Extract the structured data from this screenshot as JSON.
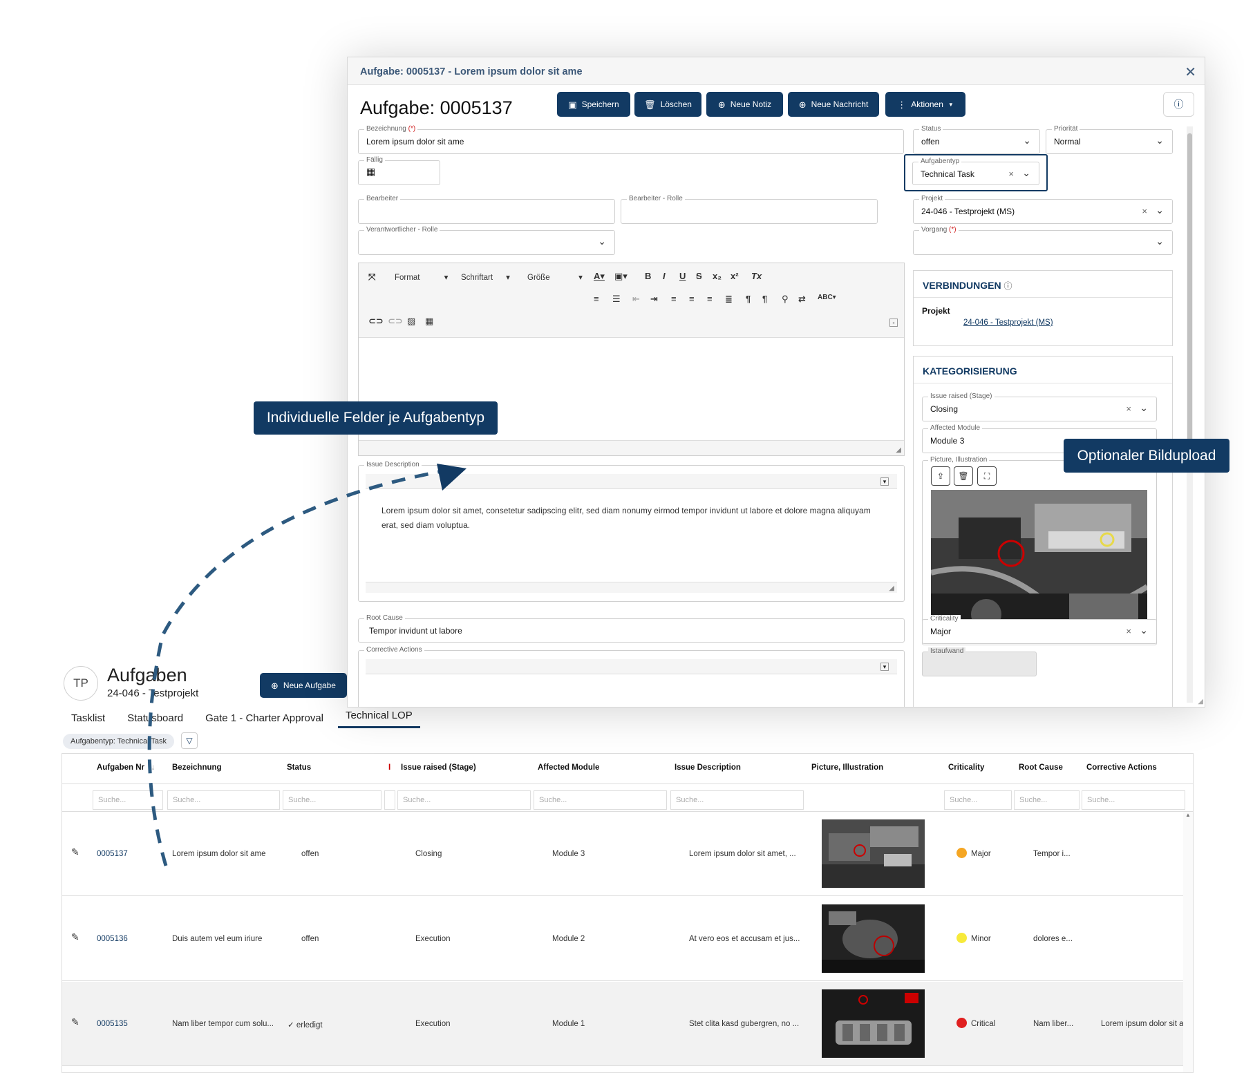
{
  "list": {
    "badge": "TP",
    "title": "Aufgaben",
    "subtitle": "24-046 - Testprojekt",
    "new_button": "Neue Aufgabe",
    "tabs": [
      {
        "label": "Tasklist"
      },
      {
        "label": "Statusboard"
      },
      {
        "label": "Gate 1 - Charter Approval"
      },
      {
        "label": "Technical LOP"
      }
    ],
    "active_tab": "Technical LOP",
    "filter_chip": "Aufgabentyp: Technical Task",
    "columns": [
      "Aufgaben Nr",
      "Bezeichnung",
      "Status",
      "I",
      "Issue raised (Stage)",
      "Affected Module",
      "Issue Description",
      "Picture, Illustration",
      "Criticality",
      "Root Cause",
      "Corrective Actions"
    ],
    "search_placeholder": "Suche...",
    "rows": [
      {
        "nr": "0005137",
        "bezeichnung": "Lorem ipsum dolor sit ame",
        "status": "offen",
        "stage": "Closing",
        "module": "Module 3",
        "description": "Lorem ipsum dolor sit amet, ...",
        "criticality": "Major",
        "crit_color": "#f5a623",
        "root_cause": "Tempor i...",
        "corrective": ""
      },
      {
        "nr": "0005136",
        "bezeichnung": "Duis autem vel eum iriure",
        "status": "offen",
        "stage": "Execution",
        "module": "Module 2",
        "description": "At vero eos et accusam et jus...",
        "criticality": "Minor",
        "crit_color": "#f7ea3b",
        "root_cause": "dolores e...",
        "corrective": ""
      },
      {
        "nr": "0005135",
        "bezeichnung": "Nam liber tempor cum solu...",
        "status": "erledigt",
        "stage": "Execution",
        "module": "Module 1",
        "description": "Stet clita kasd gubergren, no ...",
        "criticality": "Critical",
        "crit_color": "#e02020",
        "root_cause": "Nam liber...",
        "corrective": "Lorem ipsum dolor sit a"
      }
    ]
  },
  "modal": {
    "titlebar": "Aufgabe: 0005137 - Lorem ipsum dolor sit ame",
    "title": "Aufgabe: 0005137",
    "buttons": {
      "save": "Speichern",
      "delete": "Löschen",
      "note": "Neue Notiz",
      "message": "Neue Nachricht",
      "actions": "Aktionen"
    },
    "fields": {
      "bezeichnung": {
        "label": "Bezeichnung",
        "req": "(*)",
        "value": "Lorem ipsum dolor sit ame"
      },
      "status": {
        "label": "Status",
        "value": "offen"
      },
      "prioritaet": {
        "label": "Priorität",
        "value": "Normal"
      },
      "faellig": {
        "label": "Fällig"
      },
      "aufgabentyp": {
        "label": "Aufgabentyp",
        "value": "Technical Task"
      },
      "bearbeiter": {
        "label": "Bearbeiter"
      },
      "bearbeiter_rolle": {
        "label": "Bearbeiter - Rolle"
      },
      "projekt": {
        "label": "Projekt",
        "value": "24-046 - Testprojekt (MS)"
      },
      "verantwortlicher_rolle": {
        "label": "Verantwortlicher - Rolle"
      },
      "vorgang": {
        "label": "Vorgang",
        "req": "(*)"
      },
      "issue_description": {
        "label": "Issue Description",
        "value": "Lorem ipsum dolor sit amet, consetetur sadipscing elitr, sed diam nonumy eirmod tempor invidunt ut labore et dolore magna aliquyam erat, sed diam voluptua."
      },
      "root_cause": {
        "label": "Root Cause",
        "value": "Tempor invidunt ut labore"
      },
      "corrective_actions": {
        "label": "Corrective Actions"
      }
    },
    "toolbar": {
      "format": "Format",
      "font": "Schriftart",
      "size": "Größe"
    },
    "verbindungen": {
      "heading": "VERBINDUNGEN",
      "label": "Projekt",
      "link": "24-046 - Testprojekt (MS)"
    },
    "kategorisierung": {
      "heading": "KATEGORISIERUNG",
      "issue_raised": {
        "label": "Issue raised (Stage)",
        "value": "Closing"
      },
      "affected_module": {
        "label": "Affected Module",
        "value": "Module 3"
      },
      "picture": {
        "label": "Picture, Illustration"
      },
      "criticality": {
        "label": "Criticality",
        "value": "Major"
      },
      "istaufwand": {
        "label": "Istaufwand"
      }
    }
  },
  "callouts": {
    "fields_per_type": "Individuelle Felder je Aufgabentyp",
    "image_upload": "Optionaler Bildupload"
  },
  "colors": {
    "primary": "#123a63",
    "title": "#3c5878"
  }
}
